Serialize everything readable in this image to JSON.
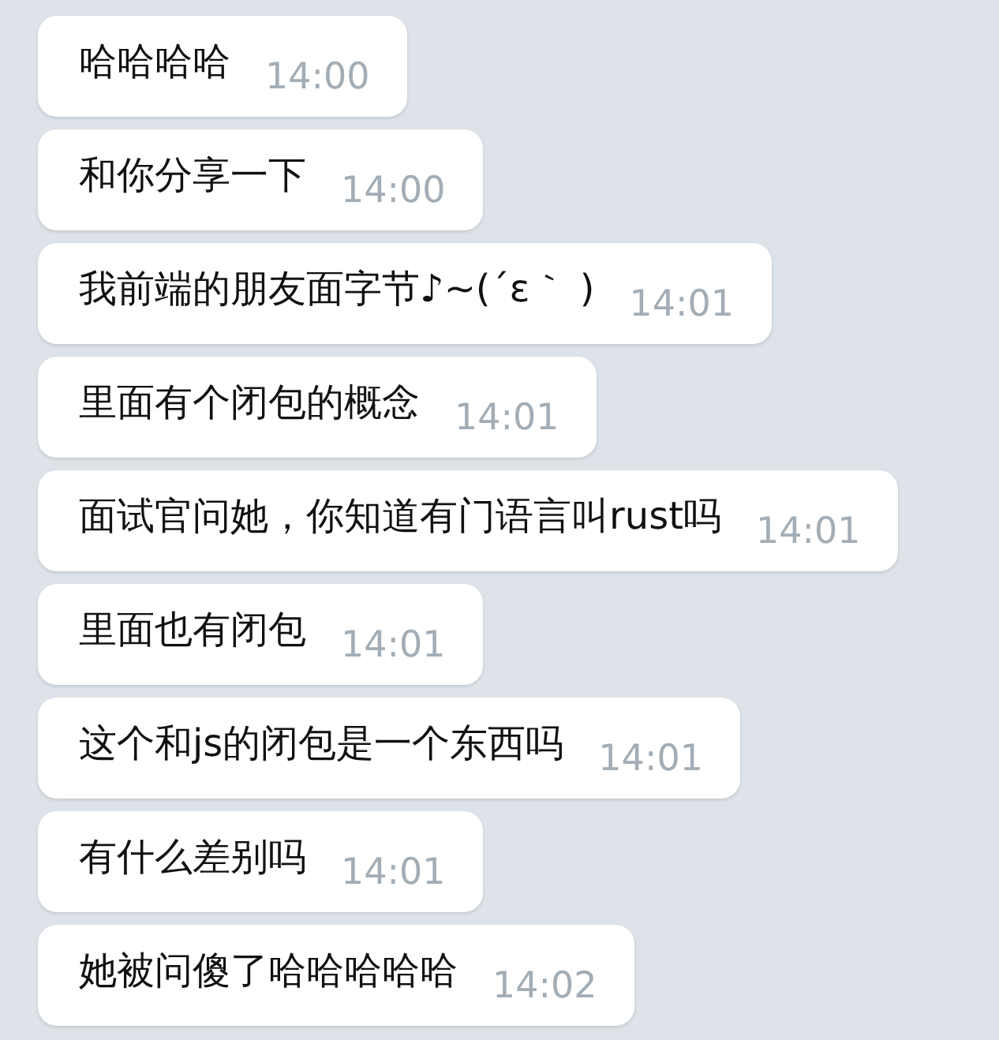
{
  "messages": [
    {
      "text": "哈哈哈哈",
      "time": "14:00"
    },
    {
      "text": "和你分享一下",
      "time": "14:00"
    },
    {
      "text": "我前端的朋友面字节♪~(´ε｀ )",
      "time": "14:01"
    },
    {
      "text": "里面有个闭包的概念",
      "time": "14:01"
    },
    {
      "text": "面试官问她，你知道有门语言叫rust吗",
      "time": "14:01"
    },
    {
      "text": "里面也有闭包",
      "time": "14:01"
    },
    {
      "text": "这个和js的闭包是一个东西吗",
      "time": "14:01"
    },
    {
      "text": "有什么差别吗",
      "time": "14:01"
    },
    {
      "text": "她被问傻了哈哈哈哈哈",
      "time": "14:02"
    }
  ]
}
